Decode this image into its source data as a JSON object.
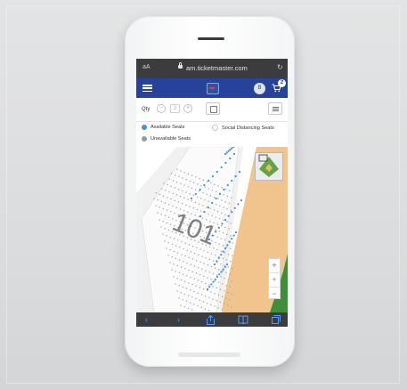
{
  "browser": {
    "text_size_label": "aA",
    "url": "am.ticketmaster.com",
    "reload_icon": "reload-icon"
  },
  "nav": {
    "avatar_initial": "B",
    "cart_count": "2"
  },
  "qty": {
    "label": "Qty",
    "minus": "−",
    "value": "2",
    "plus": "+"
  },
  "legend": {
    "available": "Available Seats",
    "social_distancing": "Social Distancing Seats",
    "unavailable": "Unavailable Seats",
    "colors": {
      "available": "#4a90d9",
      "social_distancing": "#ffffff",
      "unavailable": "#9b9b9b"
    }
  },
  "map": {
    "section_label": "101",
    "zoom_in": "+",
    "zoom_out": "−",
    "field_color": "#f2c48d",
    "grass_color": "#3f8f3a"
  },
  "colors": {
    "nav_bg": "#25439b",
    "browser_chrome": "#3c3c3e",
    "toolbar_icon": "#5a9cf5"
  }
}
